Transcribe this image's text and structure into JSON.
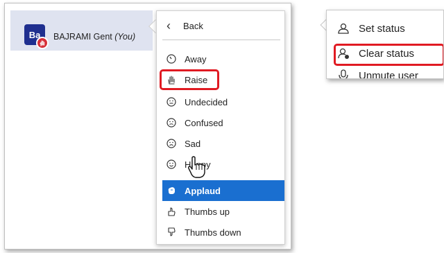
{
  "user": {
    "initials": "Ba",
    "name": "BAJRAMI Gent",
    "you_tag": "(You)"
  },
  "menu": {
    "back_label": "Back",
    "items": [
      {
        "label": "Away",
        "icon": "clock-icon"
      },
      {
        "label": "Raise",
        "icon": "hand-icon"
      },
      {
        "label": "Undecided",
        "icon": "neutral-face-icon"
      },
      {
        "label": "Confused",
        "icon": "confused-face-icon"
      },
      {
        "label": "Sad",
        "icon": "sad-face-icon"
      },
      {
        "label": "Happy",
        "icon": "happy-face-icon"
      },
      {
        "label": "Applaud",
        "icon": "applaud-icon"
      },
      {
        "label": "Thumbs up",
        "icon": "thumbs-up-icon"
      },
      {
        "label": "Thumbs down",
        "icon": "thumbs-down-icon"
      }
    ],
    "active_item": "Applaud",
    "highlighted_item": "Raise"
  },
  "user_options": {
    "items": [
      {
        "label": "Set status",
        "icon": "user-icon"
      },
      {
        "label": "Clear status",
        "icon": "user-clear-icon"
      },
      {
        "label": "Unmute user",
        "icon": "microphone-icon"
      }
    ],
    "highlighted_item": "Clear status"
  },
  "partial_text": [
    "t",
    "i"
  ],
  "colors": {
    "accent": "#1a6fd0",
    "highlight_border": "#e01a22",
    "avatar": "#1f2f8f",
    "status_badge": "#d6303a",
    "selected_row": "#dfe3f0"
  }
}
